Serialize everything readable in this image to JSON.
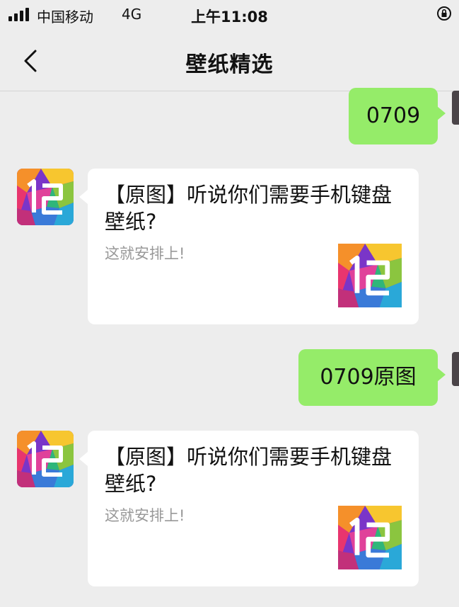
{
  "status_bar": {
    "carrier": "中国移动",
    "network": "4G",
    "time": "上午11:08"
  },
  "nav": {
    "title": "壁纸精选"
  },
  "messages": [
    {
      "type": "outgoing",
      "text": "0709"
    },
    {
      "type": "incoming_card",
      "title": "【原图】听说你们需要手机键盘壁纸?",
      "description": "这就安排上!",
      "thumb_icon": "12-logo"
    },
    {
      "type": "outgoing",
      "text": "0709原图"
    },
    {
      "type": "incoming_card",
      "title": "【原图】听说你们需要手机键盘壁纸?",
      "description": "这就安排上!",
      "thumb_icon": "12-logo"
    }
  ]
}
